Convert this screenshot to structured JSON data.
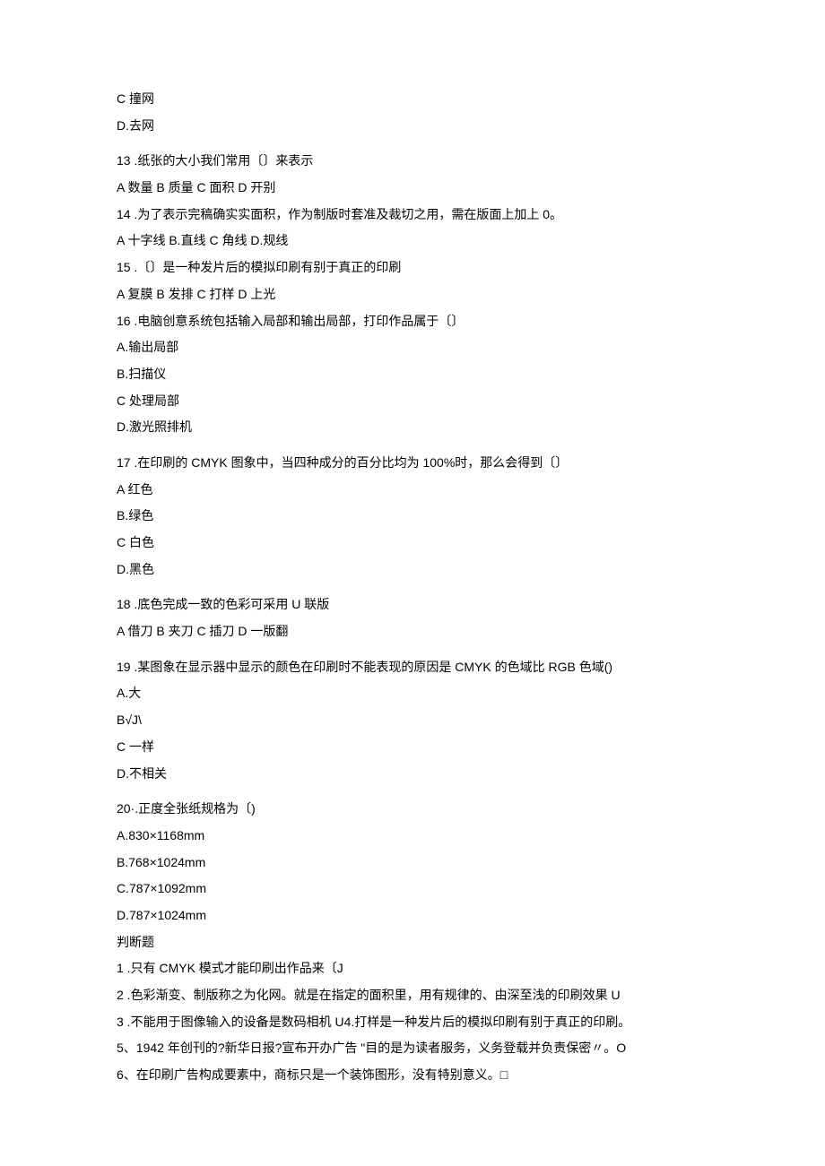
{
  "lines": [
    {
      "text": "C 撞网",
      "gap": false
    },
    {
      "text": "D.去网",
      "gap": false
    },
    {
      "text": "13 .纸张的大小我们常用〔〕来表示",
      "gap": true
    },
    {
      "text": "A 数量 B 质量 C 面积 D 开别",
      "gap": false
    },
    {
      "text": "14 .为了表示完稿确实实面积，作为制版时套准及裁切之用，需在版面上加上 0。",
      "gap": false
    },
    {
      "text": "A 十字线 B.直线 C 角线 D.规线",
      "gap": false
    },
    {
      "text": "15 .〔〕是一种发片后的模拟印刷有别于真正的印刷",
      "gap": false
    },
    {
      "text": "A 复膜 B 发排 C 打样 D 上光",
      "gap": false
    },
    {
      "text": "16 .电脑创意系统包括输入局部和输出局部，打印作品属于〔〕",
      "gap": false
    },
    {
      "text": "A.输出局部",
      "gap": false
    },
    {
      "text": "B.扫描仪",
      "gap": false
    },
    {
      "text": "C 处理局部",
      "gap": false
    },
    {
      "text": "D.激光照排机",
      "gap": false
    },
    {
      "text": "17 .在印刷的 CMYK 图象中，当四种成分的百分比均为 100%时，那么会得到〔〕",
      "gap": true
    },
    {
      "text": "A 红色",
      "gap": false
    },
    {
      "text": "B.绿色",
      "gap": false
    },
    {
      "text": "C 白色",
      "gap": false
    },
    {
      "text": "D.黑色",
      "gap": false
    },
    {
      "text": "18 .底色完成一致的色彩可采用 U 联版",
      "gap": true
    },
    {
      "text": "A 借刀 B 夹刀 C 插刀 D 一版翻",
      "gap": false
    },
    {
      "text": "19 .某图象在显示器中显示的颜色在印刷时不能表现的原因是 CMYK 的色域比 RGB 色域()",
      "gap": true
    },
    {
      "text": "A.大",
      "gap": false
    },
    {
      "text": "B√J\\",
      "gap": false
    },
    {
      "text": "C 一样",
      "gap": false
    },
    {
      "text": "D.不相关",
      "gap": false
    },
    {
      "text": "20·.正度全张纸规格为〔)",
      "gap": true
    },
    {
      "text": "A.830×1168mm",
      "gap": false
    },
    {
      "text": "B.768×1024mm",
      "gap": false
    },
    {
      "text": "C.787×1092mm",
      "gap": false
    },
    {
      "text": "D.787×1024mm",
      "gap": false
    },
    {
      "text": "判断题",
      "gap": false
    },
    {
      "text": "1 .只有 CMYK 模式才能印刷出作品来〔J",
      "gap": false
    },
    {
      "text": "2 .色彩渐变、制版称之为化网。就是在指定的面积里，用有规律的、由深至浅的印刷效果 U",
      "gap": false
    },
    {
      "text": "3 .不能用于图像输入的设备是数码相机 U4.打样是一种发片后的模拟印刷有别于真正的印刷。",
      "gap": false
    },
    {
      "text": "5、1942 年创刊的?新华日报?宣布开办广告 \"目的是为读者服务，义务登载并负责保密〃。O",
      "gap": false
    },
    {
      "text": "6、在印刷广告构成要素中，商标只是一个装饰图形，没有特别意义。□",
      "gap": false
    }
  ]
}
